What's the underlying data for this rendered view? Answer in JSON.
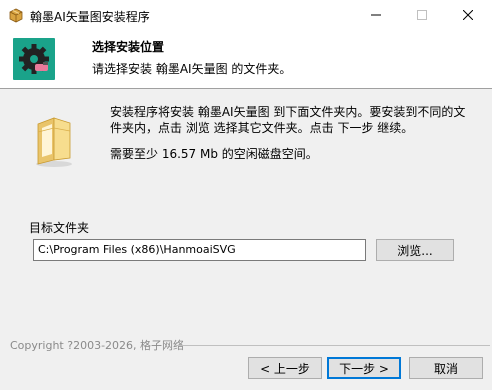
{
  "window": {
    "title": "翰墨AI矢量图安装程序",
    "minimize_glyph": "—",
    "maximize_glyph": "☐",
    "close_glyph": "✕"
  },
  "header": {
    "title": "选择安装位置",
    "subtitle": "请选择安装 翰墨AI矢量图 的文件夹。"
  },
  "info": {
    "line1": "安装程序将安装 翰墨AI矢量图 到下面文件夹内。要安装到不同的文",
    "line2": "件夹内，点击 浏览 选择其它文件夹。点击 下一步 继续。",
    "space_required": "需要至少 16.57 Mb 的空闲磁盘空间。"
  },
  "destination": {
    "label": "目标文件夹",
    "path": "C:\\Program Files (x86)\\HanmoaiSVG",
    "browse_label": "浏览..."
  },
  "footer": {
    "copyright": "Copyright ?2003-2026, 格子网络"
  },
  "buttons": {
    "back": "< 上一步",
    "next": "下一步 >",
    "cancel": "取消"
  },
  "colors": {
    "logo_bg": "#1aa38a",
    "body_bg": "#f0f0f0",
    "default_button_border": "#0078d7"
  },
  "icons": {
    "app": "installer-box-icon",
    "logo": "gear-brush-logo-icon",
    "folder": "folder-icon"
  }
}
